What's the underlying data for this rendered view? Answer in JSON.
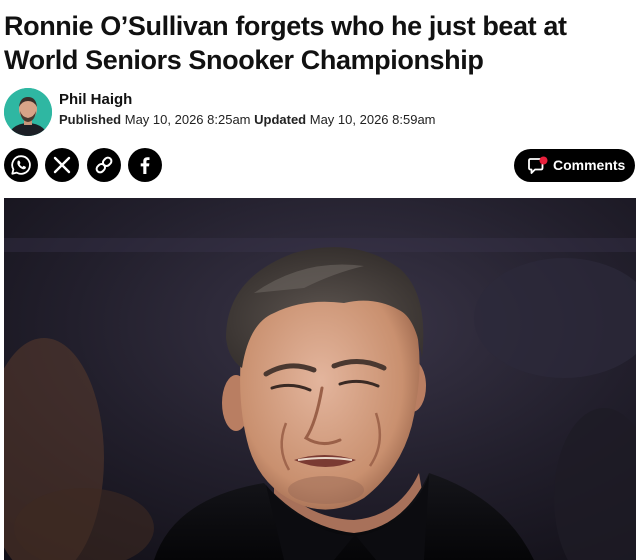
{
  "article": {
    "headline": "Ronnie O’Sullivan forgets who he just beat at World Seniors Snooker Championship"
  },
  "author": {
    "name": "Phil Haigh",
    "avatar_icon": "author-portrait",
    "published_label": "Published",
    "published_date": "May 10, 2026 8:25am",
    "updated_label": "Updated",
    "updated_date": "May 10, 2026 8:59am"
  },
  "share": {
    "buttons": [
      {
        "icon": "whatsapp-icon"
      },
      {
        "icon": "x-icon"
      },
      {
        "icon": "link-icon"
      },
      {
        "icon": "facebook-icon"
      }
    ]
  },
  "comments": {
    "label": "Comments",
    "icon": "comment-bubble-icon",
    "badge_color": "#e8203c"
  },
  "hero_image": {
    "subject": "ronnie-osullivan-grimace-photo"
  },
  "colors": {
    "text": "#111111",
    "button_bg": "#000000",
    "avatar_bg": "#2fb7a2",
    "badge": "#e8203c"
  }
}
